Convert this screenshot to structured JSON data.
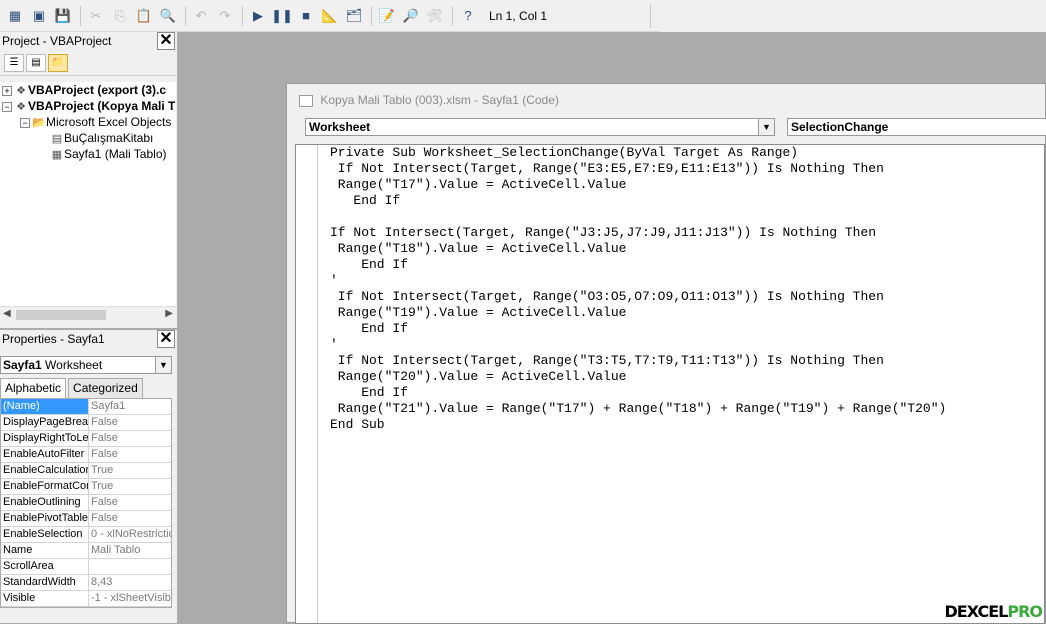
{
  "toolbar": {
    "status": "Ln 1, Col 1",
    "buttons": [
      {
        "name": "excel-icon",
        "glyph": "▦",
        "enabled": true
      },
      {
        "name": "insert-userform-icon",
        "glyph": "▣",
        "enabled": true
      },
      {
        "name": "save-icon",
        "glyph": "💾",
        "enabled": true
      },
      {
        "name": "cut-icon",
        "glyph": "✂",
        "enabled": false
      },
      {
        "name": "copy-icon",
        "glyph": "⎘",
        "enabled": false
      },
      {
        "name": "paste-icon",
        "glyph": "📋",
        "enabled": false
      },
      {
        "name": "find-icon",
        "glyph": "🔍",
        "enabled": false
      },
      {
        "name": "undo-icon",
        "glyph": "↶",
        "enabled": false
      },
      {
        "name": "redo-icon",
        "glyph": "↷",
        "enabled": false
      },
      {
        "name": "run-icon",
        "glyph": "▶",
        "enabled": true
      },
      {
        "name": "break-icon",
        "glyph": "❚❚",
        "enabled": true
      },
      {
        "name": "reset-icon",
        "glyph": "■",
        "enabled": true
      },
      {
        "name": "design-mode-icon",
        "glyph": "📐",
        "enabled": true
      },
      {
        "name": "project-explorer-icon",
        "glyph": "🗂",
        "enabled": true
      },
      {
        "name": "properties-window-icon",
        "glyph": "📝",
        "enabled": true
      },
      {
        "name": "object-browser-icon",
        "glyph": "🔎",
        "enabled": true
      },
      {
        "name": "toolbox-icon",
        "glyph": "🛠",
        "enabled": false
      },
      {
        "name": "help-icon",
        "glyph": "?",
        "enabled": true
      }
    ]
  },
  "project": {
    "title": "Project - VBAProject",
    "tree": [
      {
        "label": "VBAProject (export (3).c",
        "level": 0,
        "expander": "+",
        "bold": true,
        "icon": "vba-project-icon",
        "glyph": "❖"
      },
      {
        "label": "VBAProject (Kopya Mali T",
        "level": 0,
        "expander": "−",
        "bold": true,
        "icon": "vba-project-icon",
        "glyph": "❖"
      },
      {
        "label": "Microsoft Excel Objects",
        "level": 1,
        "expander": "−",
        "bold": false,
        "icon": "folder-icon",
        "glyph": "📂"
      },
      {
        "label": "BuÇalışmaKitabı",
        "level": 2,
        "expander": "",
        "bold": false,
        "icon": "workbook-icon",
        "glyph": "▤"
      },
      {
        "label": "Sayfa1 (Mali Tablo)",
        "level": 2,
        "expander": "",
        "bold": false,
        "icon": "worksheet-icon",
        "glyph": "▦"
      }
    ]
  },
  "properties": {
    "title": "Properties - Sayfa1",
    "object_name": "Sayfa1",
    "object_type": "Worksheet",
    "tabs": [
      "Alphabetic",
      "Categorized"
    ],
    "rows": [
      {
        "key": "(Name)",
        "value": "Sayfa1"
      },
      {
        "key": "DisplayPageBreak",
        "value": "False"
      },
      {
        "key": "DisplayRightToLef",
        "value": "False"
      },
      {
        "key": "EnableAutoFilter",
        "value": "False"
      },
      {
        "key": "EnableCalculation",
        "value": "True"
      },
      {
        "key": "EnableFormatCon",
        "value": "True"
      },
      {
        "key": "EnableOutlining",
        "value": "False"
      },
      {
        "key": "EnablePivotTable",
        "value": "False"
      },
      {
        "key": "EnableSelection",
        "value": "0 - xlNoRestrictic"
      },
      {
        "key": "Name",
        "value": "Mali Tablo"
      },
      {
        "key": "ScrollArea",
        "value": ""
      },
      {
        "key": "StandardWidth",
        "value": "8,43"
      },
      {
        "key": "Visible",
        "value": "-1 - xlSheetVisib"
      }
    ]
  },
  "code_window": {
    "title": "Kopya Mali Tablo (003).xlsm - Sayfa1 (Code)",
    "object_combo": "Worksheet",
    "procedure_combo": "SelectionChange",
    "code": "Private Sub Worksheet_SelectionChange(ByVal Target As Range)\n If Not Intersect(Target, Range(\"E3:E5,E7:E9,E11:E13\")) Is Nothing Then\n Range(\"T17\").Value = ActiveCell.Value\n   End If\n\nIf Not Intersect(Target, Range(\"J3:J5,J7:J9,J11:J13\")) Is Nothing Then\n Range(\"T18\").Value = ActiveCell.Value\n    End If\n'\n If Not Intersect(Target, Range(\"O3:O5,O7:O9,O11:O13\")) Is Nothing Then\n Range(\"T19\").Value = ActiveCell.Value\n    End If\n'\n If Not Intersect(Target, Range(\"T3:T5,T7:T9,T11:T13\")) Is Nothing Then\n Range(\"T20\").Value = ActiveCell.Value\n    End If\n Range(\"T21\").Value = Range(\"T17\") + Range(\"T18\") + Range(\"T19\") + Range(\"T20\")\nEnd Sub"
  },
  "watermark": {
    "part1": "DEXCEL",
    "part2": "PRO"
  }
}
